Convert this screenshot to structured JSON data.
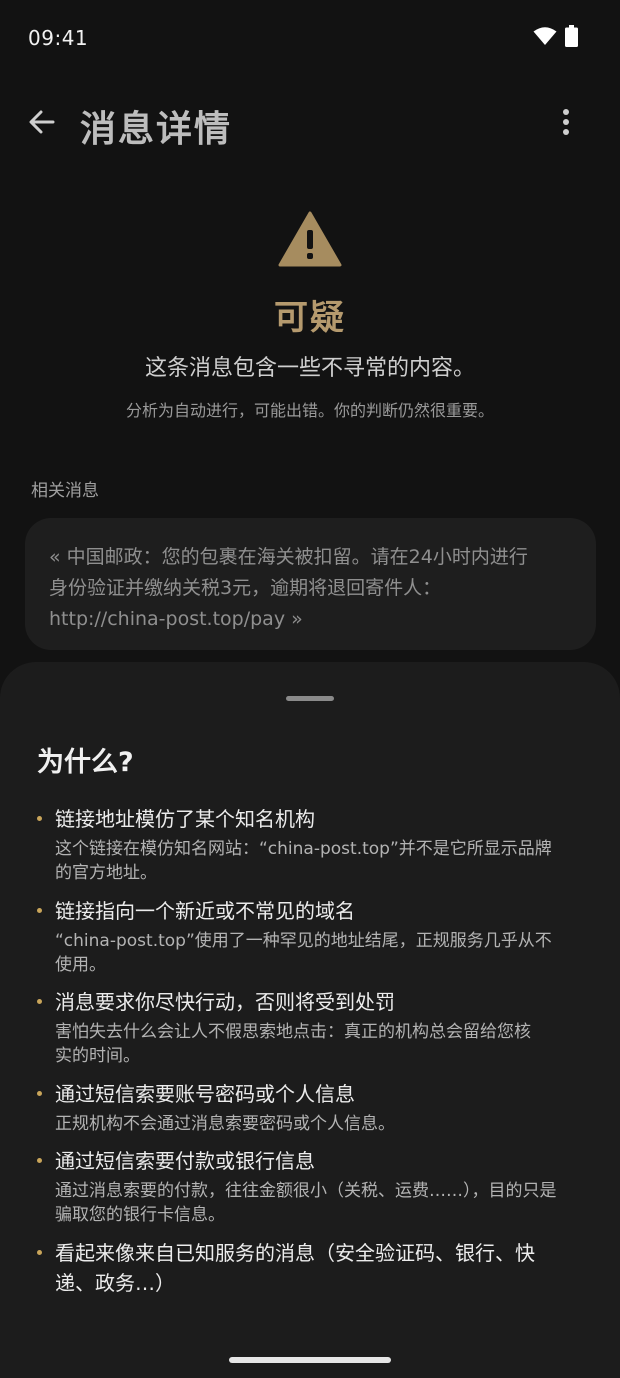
{
  "status_bar": {
    "time": "09:41"
  },
  "app_bar": {
    "title": "消息详情"
  },
  "verdict": {
    "label": "可疑",
    "description": "这条消息包含一些不寻常的内容。",
    "disclaimer": "分析为自动进行，可能出错。你的判断仍然很重要。",
    "accent_color": "#b59a6e"
  },
  "related": {
    "label": "相关消息",
    "message_lines": [
      "« 中国邮政：您的包裹在海关被扣留。请在24小时内进行",
      "身份验证并缴纳关税3元，逾期将退回寄件人：",
      "http://china-post.top/pay »"
    ]
  },
  "why": {
    "title": "为什么?",
    "reasons": [
      {
        "title": "链接地址模仿了某个知名机构",
        "body_lines": [
          "这个链接在模仿知名网站：“china-post.top”并不是它所显示品牌",
          "的官方地址。"
        ]
      },
      {
        "title": "链接指向一个新近或不常见的域名",
        "body_lines": [
          "“china-post.top”使用了一种罕见的地址结尾，正规服务几乎从不",
          "使用。"
        ]
      },
      {
        "title": "消息要求你尽快行动，否则将受到处罚",
        "body_lines": [
          "害怕失去什么会让人不假思索地点击：真正的机构总会留给您核",
          "实的时间。"
        ]
      },
      {
        "title": "通过短信索要账号密码或个人信息",
        "body_lines": [
          "正规机构不会通过消息索要密码或个人信息。"
        ]
      },
      {
        "title": "通过短信索要付款或银行信息",
        "body_lines": [
          "通过消息索要的付款，往往金额很小（关税、运费……），目的只是",
          "骗取您的银行卡信息。"
        ]
      },
      {
        "title_lines": [
          "看起来像来自已知服务的消息（安全验证码、银行、快",
          "递、政务…）"
        ]
      }
    ]
  }
}
